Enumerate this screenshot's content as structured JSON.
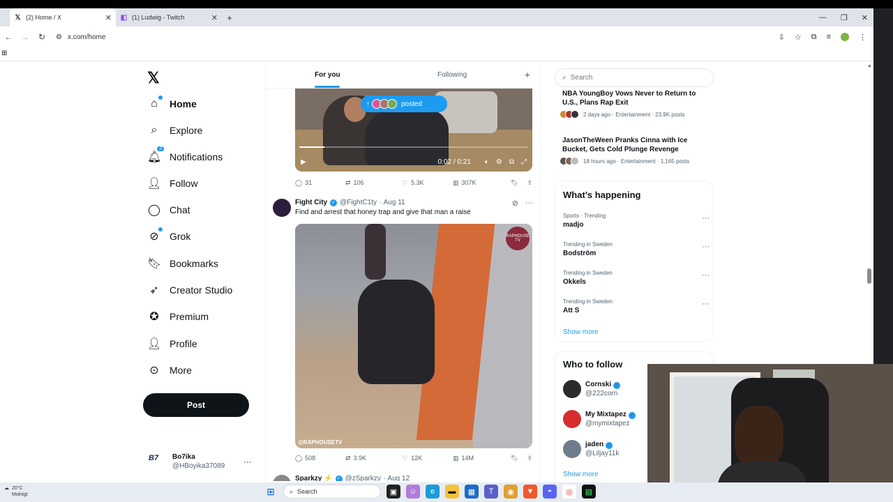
{
  "browser": {
    "tabs": [
      {
        "title": "(2) Home / X",
        "icon": "x-logo-icon",
        "active": true
      },
      {
        "title": "(1) Ludwig - Twitch",
        "icon": "twitch-icon",
        "active": false
      }
    ],
    "url": "x.com/home"
  },
  "nav": {
    "items": [
      {
        "label": "Home",
        "icon": "home-icon"
      },
      {
        "label": "Explore",
        "icon": "search-icon"
      },
      {
        "label": "Notifications",
        "icon": "bell-icon",
        "badge": "2"
      },
      {
        "label": "Follow",
        "icon": "person-plus-icon"
      },
      {
        "label": "Chat",
        "icon": "chat-icon"
      },
      {
        "label": "Grok",
        "icon": "grok-icon"
      },
      {
        "label": "Bookmarks",
        "icon": "bookmark-icon"
      },
      {
        "label": "Creator Studio",
        "icon": "rocket-icon"
      },
      {
        "label": "Premium",
        "icon": "verified-icon"
      },
      {
        "label": "Profile",
        "icon": "person-icon"
      },
      {
        "label": "More",
        "icon": "more-circle-icon"
      }
    ],
    "post_label": "Post",
    "account": {
      "name": "Bo7ika",
      "handle": "@HBoyika37089",
      "avatar_text": "B7"
    }
  },
  "feed": {
    "tabs": [
      "For you",
      "Following"
    ],
    "posted_pill": "posted",
    "video": {
      "time": "0:02 / 0:21",
      "progress": 0.11
    },
    "post1_actions": {
      "replies": "31",
      "reposts": "106",
      "likes": "5.3K",
      "views": "307K"
    },
    "post2": {
      "author": "Fight City",
      "handle": "@FightC1ty",
      "date": "· Aug 11",
      "text": "Find and arrest that honey trap and give that man a raise",
      "watermark": "@RAPHOUSETV",
      "logo_text": "RAPHOUSE TV",
      "actions": {
        "replies": "508",
        "reposts": "3.9K",
        "likes": "12K",
        "views": "14M"
      }
    },
    "post3": {
      "author": "Sparkzy ⚡",
      "handle": "@zSparkzy",
      "date": "· Aug 12"
    }
  },
  "sidebar": {
    "search_placeholder": "Search",
    "news": [
      {
        "headline": "NBA YoungBoy Vows Never to Return to U.S., Plans Rap Exit",
        "meta": "2 days ago · Entertainment · 23.9K posts"
      },
      {
        "headline": "JasonTheWeen Pranks Cinna with Ice Bucket, Gets Cold Plunge Revenge",
        "meta": "18 hours ago · Entertainment · 1,165 posts"
      }
    ],
    "happening_title": "What’s happening",
    "trends": [
      {
        "context": "Sports · Trending",
        "name": "madjo"
      },
      {
        "context": "Trending in Sweden",
        "name": "Bodström"
      },
      {
        "context": "Trending in Sweden",
        "name": "Okkels"
      },
      {
        "context": "Trending in Sweden",
        "name": "Att S"
      }
    ],
    "show_more": "Show more",
    "wtf_title": "Who to follow",
    "who_to_follow": [
      {
        "name": "Cornski",
        "handle": "@222corn",
        "color": "#2b2b2b"
      },
      {
        "name": "My Mixtapez",
        "handle": "@mymixtapez",
        "color": "#d62e2e"
      },
      {
        "name": "jaden",
        "handle": "@Liljay11k",
        "color": "#6f7c8b"
      }
    ],
    "wtf_show_more": "Show more"
  },
  "taskbar": {
    "temp": "20°C",
    "weather_text": "Molnigt",
    "search_label": "Search"
  }
}
